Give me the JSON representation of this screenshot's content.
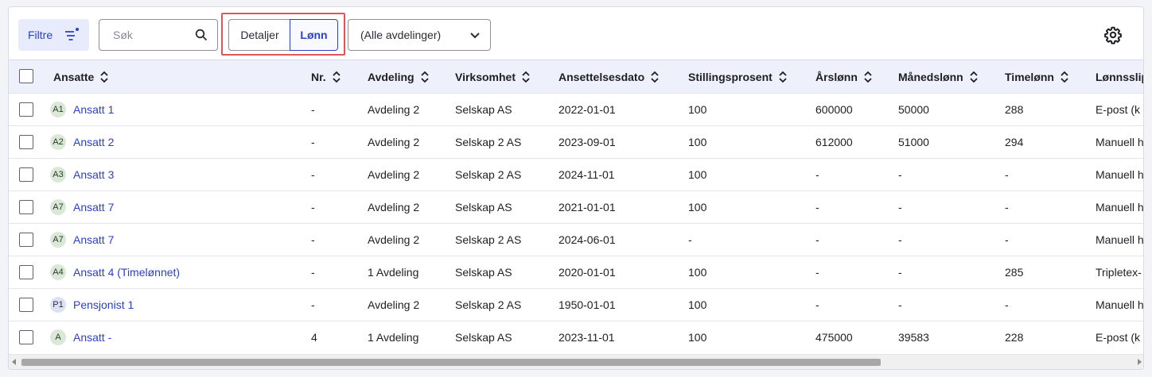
{
  "toolbar": {
    "filter_label": "Filtre",
    "search_placeholder": "Søk",
    "view_toggle": {
      "details_label": "Detaljer",
      "salary_label": "Lønn",
      "active": "Lønn"
    },
    "department_select": "(Alle avdelinger)"
  },
  "columns": [
    "Ansatte",
    "Nr.",
    "Avdeling",
    "Virksomhet",
    "Ansettelsesdato",
    "Stillingsprosent",
    "Årslønn",
    "Månedslønn",
    "Timelønn",
    "Lønnsslip"
  ],
  "rows": [
    {
      "initials": "A1",
      "name": "Ansatt 1",
      "nr": "-",
      "department": "Avdeling 2",
      "company": "Selskap AS",
      "start_date": "2022-01-01",
      "position_pct": "100",
      "annual": "600000",
      "monthly": "50000",
      "hourly": "288",
      "payslip": "E-post (k"
    },
    {
      "initials": "A2",
      "name": "Ansatt 2",
      "nr": "-",
      "department": "Avdeling 2",
      "company": "Selskap 2 AS",
      "start_date": "2023-09-01",
      "position_pct": "100",
      "annual": "612000",
      "monthly": "51000",
      "hourly": "294",
      "payslip": "Manuell h"
    },
    {
      "initials": "A3",
      "name": "Ansatt 3",
      "nr": "-",
      "department": "Avdeling 2",
      "company": "Selskap 2 AS",
      "start_date": "2024-11-01",
      "position_pct": "100",
      "annual": "-",
      "monthly": "-",
      "hourly": "-",
      "payslip": "Manuell h"
    },
    {
      "initials": "A7",
      "name": "Ansatt 7",
      "nr": "-",
      "department": "Avdeling 2",
      "company": "Selskap AS",
      "start_date": "2021-01-01",
      "position_pct": "100",
      "annual": "-",
      "monthly": "-",
      "hourly": "-",
      "payslip": "Manuell h"
    },
    {
      "initials": "A7",
      "name": "Ansatt 7",
      "nr": "-",
      "department": "Avdeling 2",
      "company": "Selskap 2 AS",
      "start_date": "2024-06-01",
      "position_pct": "-",
      "annual": "-",
      "monthly": "-",
      "hourly": "-",
      "payslip": "Manuell h"
    },
    {
      "initials": "A4",
      "name": "Ansatt 4 (Timelønnet)",
      "nr": "-",
      "department": "1 Avdeling",
      "company": "Selskap AS",
      "start_date": "2020-01-01",
      "position_pct": "100",
      "annual": "-",
      "monthly": "-",
      "hourly": "285",
      "payslip": "Tripletex-"
    },
    {
      "initials": "P1",
      "name": "Pensjonist 1",
      "nr": "-",
      "department": "Avdeling 2",
      "company": "Selskap 2 AS",
      "start_date": "1950-01-01",
      "position_pct": "100",
      "annual": "-",
      "monthly": "-",
      "hourly": "-",
      "payslip": "Manuell h"
    },
    {
      "initials": "A",
      "name": "Ansatt -",
      "nr": "4",
      "department": "1 Avdeling",
      "company": "Selskap AS",
      "start_date": "2023-11-01",
      "position_pct": "100",
      "annual": "475000",
      "monthly": "39583",
      "hourly": "228",
      "payslip": "E-post (k"
    }
  ],
  "colors": {
    "accent": "#2c40c8",
    "highlight_border": "#e0545b",
    "header_bg": "#eef1fb"
  }
}
